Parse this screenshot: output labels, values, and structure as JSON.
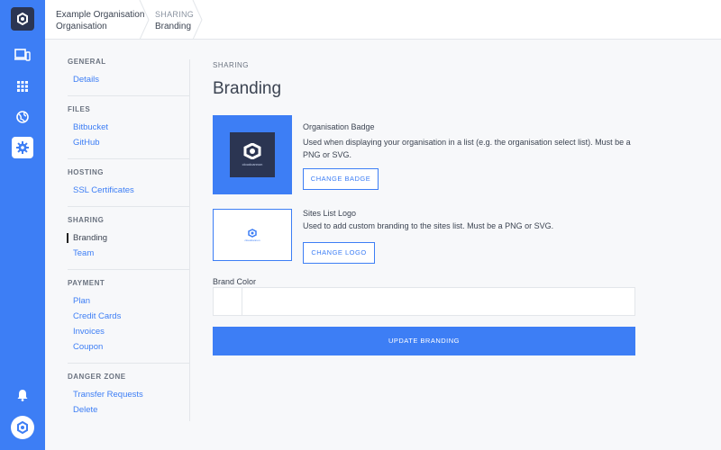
{
  "breadcrumb": [
    {
      "line1": "Example Organisation",
      "line2": "Organisation"
    },
    {
      "line1": "SHARING",
      "line2": "Branding"
    }
  ],
  "rail": {
    "items": [
      "devices-icon",
      "grid-icon",
      "globe-icon",
      "gear-icon",
      "bell-icon"
    ],
    "active": "gear-icon"
  },
  "nav": {
    "groups": [
      {
        "heading": "GENERAL",
        "items": [
          "Details"
        ]
      },
      {
        "heading": "FILES",
        "items": [
          "Bitbucket",
          "GitHub"
        ]
      },
      {
        "heading": "HOSTING",
        "items": [
          "SSL Certificates"
        ]
      },
      {
        "heading": "SHARING",
        "items": [
          "Branding",
          "Team"
        ]
      },
      {
        "heading": "PAYMENT",
        "items": [
          "Plan",
          "Credit Cards",
          "Invoices",
          "Coupon"
        ]
      },
      {
        "heading": "DANGER ZONE",
        "items": [
          "Transfer Requests",
          "Delete"
        ]
      }
    ],
    "active_item": "Branding"
  },
  "main": {
    "section_label": "SHARING",
    "title": "Branding",
    "badge": {
      "title": "Organisation Badge",
      "description": "Used when displaying your organisation in a list (e.g. the organisation select list). Must be a PNG or SVG.",
      "button": "CHANGE BADGE",
      "logo_word": "cloudcannon"
    },
    "logo": {
      "title": "Sites List Logo",
      "description": "Used to add custom branding to the sites list. Must be a PNG or SVG.",
      "button": "CHANGE LOGO",
      "logo_word": "cloudcannon"
    },
    "brand_color": {
      "label": "Brand Color",
      "value": "",
      "placeholder": ""
    },
    "update_button": "UPDATE BRANDING"
  },
  "colors": {
    "accent": "#3d7ef5",
    "dark": "#2b3552",
    "background": "#f7f8fa"
  }
}
